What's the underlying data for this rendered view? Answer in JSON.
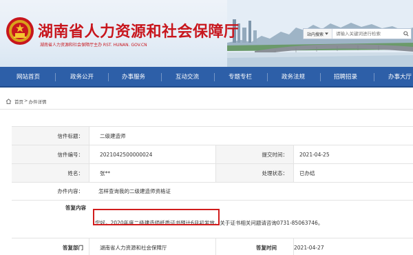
{
  "header": {
    "title": "湖南省人力资源和社会保障厅",
    "subtitle": "湖南省人力资源和社会保障厅主办 RST. HUNAN. GOV.CN"
  },
  "search": {
    "scope_label": "站内搜索",
    "placeholder": "请输入关键词进行检索"
  },
  "nav": {
    "items": [
      "网站首页",
      "政务公开",
      "办事服务",
      "互动交流",
      "专题专栏",
      "政务法规",
      "招聘招录",
      "办事大厅"
    ]
  },
  "breadcrumb": {
    "home": "首页",
    "separator": ">",
    "current": "办件详情"
  },
  "detail": {
    "labels": {
      "title": "信件标题：",
      "number": "信件编号：",
      "submit_date": "提交时间：",
      "name": "姓名：",
      "status": "处理状态：",
      "content": "办件内容：",
      "reply": "答复内容",
      "dept": "答复部门",
      "reply_date": "答复时间"
    },
    "values": {
      "title": "二级建造师",
      "number": "2021042500000024",
      "submit_date": "2021-04-25",
      "name": "张**",
      "status": "已办结",
      "content": "怎样查询我的二级建造师资格证",
      "reply_part1": "您好，2020年度二级建造师纸质证书预计6月初发放。",
      "reply_part2": "关于证书相关问题请咨询0731-85063746。",
      "dept": "湖南省人力资源和社会保障厅",
      "reply_date": "2021-04-27"
    }
  },
  "colors": {
    "brand_red": "#c8161d",
    "nav_blue": "#2d5fa8",
    "highlight_red": "#d11c1c"
  }
}
